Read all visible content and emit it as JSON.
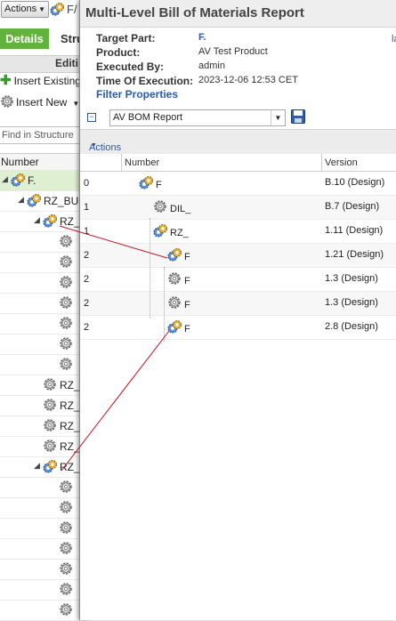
{
  "background_window": {
    "actions_label": "Actions",
    "part_name_fragment": "F/",
    "tabs": [
      "Details",
      "Stru"
    ],
    "edit_label": "Editi",
    "insert_existing_label": "Insert Existing",
    "insert_new_label": "Insert New",
    "find_placeholder": "Find in Structure",
    "column_number": "Number",
    "tree": [
      {
        "label": "F.",
        "type": "assembly"
      },
      {
        "label": "RZ_BUI",
        "type": "assembly"
      },
      {
        "label": "RZ_",
        "type": "assembly"
      },
      {
        "label": "",
        "type": "part"
      },
      {
        "label": "",
        "type": "part"
      },
      {
        "label": "",
        "type": "part"
      },
      {
        "label": "",
        "type": "part"
      },
      {
        "label": "",
        "type": "part"
      },
      {
        "label": "",
        "type": "part"
      },
      {
        "label": "",
        "type": "part"
      },
      {
        "label": "RZ_",
        "type": "part"
      },
      {
        "label": "RZ_",
        "type": "part"
      },
      {
        "label": "RZ_",
        "type": "part"
      },
      {
        "label": "RZ_",
        "type": "part"
      },
      {
        "label": "RZ_",
        "type": "assembly"
      },
      {
        "label": "",
        "type": "part"
      },
      {
        "label": "",
        "type": "part"
      },
      {
        "label": "",
        "type": "part"
      },
      {
        "label": "",
        "type": "part"
      },
      {
        "label": "",
        "type": "part"
      },
      {
        "label": "",
        "type": "part"
      },
      {
        "label": "",
        "type": "part"
      }
    ]
  },
  "dialog": {
    "title": "Multi-Level Bill of Materials Report",
    "properties": [
      {
        "key": "Target Part:",
        "value": "F.",
        "link": true
      },
      {
        "key": "Product:",
        "value": "AV Test Product",
        "link": false
      },
      {
        "key": "Executed By:",
        "value": "admin",
        "link": false
      },
      {
        "key": "Time Of Execution:",
        "value": "2023-12-06 12:53 CET",
        "link": false
      }
    ],
    "side_link": "la",
    "filter_properties_label": "Filter Properties",
    "view_select_value": "AV BOM Report",
    "actions_label": "Actions",
    "columns": [
      "Number",
      "Version"
    ],
    "rows": [
      {
        "level": "0",
        "number": "F",
        "version": "B.10 (Design)",
        "indent": 0,
        "icon": "assembly"
      },
      {
        "level": "1",
        "number": "DIL_",
        "version": "B.7 (Design)",
        "indent": 1,
        "icon": "part"
      },
      {
        "level": "1",
        "number": "RZ_",
        "version": "1.11 (Design)",
        "indent": 1,
        "icon": "assembly"
      },
      {
        "level": "2",
        "number": "F",
        "version": "1.21 (Design)",
        "indent": 2,
        "icon": "assembly"
      },
      {
        "level": "2",
        "number": "F",
        "version": "1.3 (Design)",
        "indent": 2,
        "icon": "part"
      },
      {
        "level": "2",
        "number": "F",
        "version": "1.3 (Design)",
        "indent": 2,
        "icon": "part"
      },
      {
        "level": "2",
        "number": "F",
        "version": "2.8 (Design)",
        "indent": 2,
        "icon": "assembly"
      }
    ]
  },
  "annotation_color": "#c0142a"
}
